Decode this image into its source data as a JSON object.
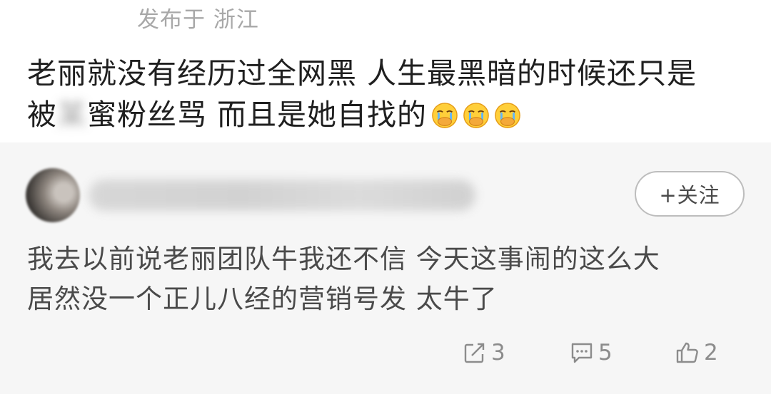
{
  "post": {
    "location": "发布于 浙江",
    "line1": "老丽就没有经历过全网黑 人生最黑暗的时候还只是",
    "line2_start": "被",
    "line2_blurred": "某",
    "line2_rest": "蜜粉丝骂 而且是她自找的",
    "emoji_name": "cry-cover-mouth-emoji",
    "emoji_count": 3
  },
  "repost": {
    "follow_label": "+关注",
    "line1": "我去以前说老丽团队牛我还不信 今天这事闹的这么大",
    "line2": "居然没一个正儿八经的营销号发 太牛了",
    "share_count": "3",
    "comment_count": "5",
    "like_count": "2"
  }
}
